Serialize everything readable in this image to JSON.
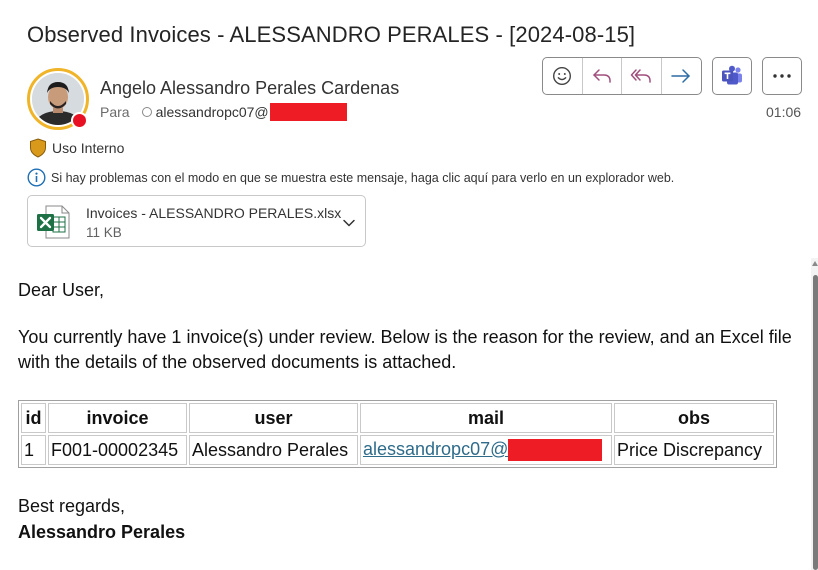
{
  "email": {
    "subject": "Observed Invoices - ALESSANDRO PERALES - [2024-08-15]",
    "sender_name": "Angelo Alessandro Perales Cardenas",
    "to_label": "Para",
    "to_address": "alessandropc07@",
    "time": "01:06",
    "sensitivity_label": "Uso Interno",
    "info_message": "Si hay problemas con el modo en que se muestra este mensaje, haga clic aquí para verlo en un explorador web.",
    "attachment": {
      "name": "Invoices - ALESSANDRO PERALES.xlsx",
      "size": "11 KB"
    }
  },
  "toolbar": {
    "icons": [
      "emoji-react-icon",
      "reply-icon",
      "reply-all-icon",
      "forward-icon",
      "teams-icon",
      "more-icon"
    ]
  },
  "body": {
    "greeting": "Dear User,",
    "paragraph": "You currently have 1 invoice(s) under review. Below is the reason for the review, and an Excel file with the details of the observed documents is attached.",
    "table": {
      "headers": [
        "id",
        "invoice",
        "user",
        "mail",
        "obs"
      ],
      "rows": [
        {
          "id": "1",
          "invoice": "F001-00002345",
          "user": "Alessandro Perales",
          "mail": "alessandropc07@",
          "obs": "Price Discrepancy"
        }
      ]
    },
    "closing": "Best regards,",
    "signature": "Alessandro Perales"
  },
  "colors": {
    "accent_ring": "#f0b429",
    "presence_busy": "#e81123",
    "redaction": "#ee1c25",
    "link": "#2e6b8a",
    "reply_icon": "#a14e7d",
    "forward_icon": "#2b6ca3",
    "excel_green": "#1e7145"
  }
}
